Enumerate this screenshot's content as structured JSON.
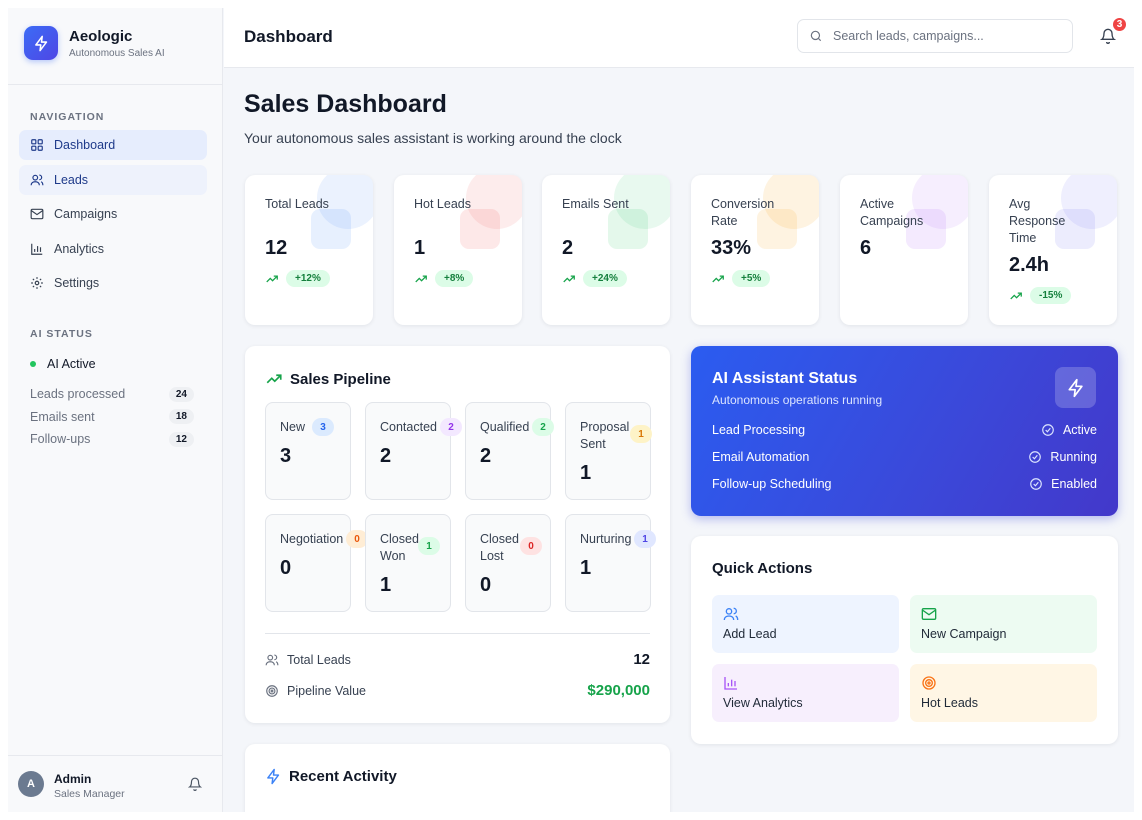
{
  "brand": {
    "name": "Aeologic",
    "subtitle": "Autonomous Sales AI"
  },
  "sidebar": {
    "nav_heading": "NAVIGATION",
    "items": [
      {
        "label": "Dashboard",
        "icon": "grid-icon",
        "state": "active"
      },
      {
        "label": "Leads",
        "icon": "users-icon",
        "state": "highlighted"
      },
      {
        "label": "Campaigns",
        "icon": "mail-icon",
        "state": "default"
      },
      {
        "label": "Analytics",
        "icon": "bar-chart-icon",
        "state": "default"
      },
      {
        "label": "Settings",
        "icon": "gear-icon",
        "state": "default"
      }
    ],
    "ai_heading": "AI STATUS",
    "ai_active_label": "AI Active",
    "stats": [
      {
        "label": "Leads processed",
        "value": "24"
      },
      {
        "label": "Emails sent",
        "value": "18"
      },
      {
        "label": "Follow-ups",
        "value": "12"
      }
    ],
    "user": {
      "initial": "A",
      "name": "Admin",
      "role": "Sales Manager"
    }
  },
  "header": {
    "title": "Dashboard",
    "search_placeholder": "Search leads, campaigns...",
    "notification_count": "3"
  },
  "main": {
    "title": "Sales Dashboard",
    "subtitle": "Your autonomous sales assistant is working around the clock",
    "kpis": [
      {
        "label": "Total Leads",
        "value": "12",
        "trend": "+12%",
        "accent": "#3b82f6"
      },
      {
        "label": "Hot Leads",
        "value": "1",
        "trend": "+8%",
        "accent": "#ef4444"
      },
      {
        "label": "Emails Sent",
        "value": "2",
        "trend": "+24%",
        "accent": "#22c55e"
      },
      {
        "label": "Conversion Rate",
        "value": "33%",
        "trend": "+5%",
        "accent": "#f59e0b"
      },
      {
        "label": "Active Campaigns",
        "value": "6",
        "trend": "",
        "accent": "#a855f7"
      },
      {
        "label": "Avg Response Time",
        "value": "2.4h",
        "trend": "-15%",
        "accent": "#6366f1"
      }
    ]
  },
  "pipeline": {
    "title": "Sales Pipeline",
    "stages": [
      {
        "name": "New",
        "count": "3",
        "badge": "3",
        "color": "#3b82f6"
      },
      {
        "name": "Contacted",
        "count": "2",
        "badge": "2",
        "color": "#a855f7"
      },
      {
        "name": "Qualified",
        "count": "2",
        "badge": "2",
        "color": "#22c55e"
      },
      {
        "name": "Proposal Sent",
        "count": "1",
        "badge": "1",
        "color": "#f59e0b"
      },
      {
        "name": "Negotiation",
        "count": "0",
        "badge": "0",
        "color": "#f97316"
      },
      {
        "name": "Closed Won",
        "count": "1",
        "badge": "1",
        "color": "#16a34a"
      },
      {
        "name": "Closed Lost",
        "count": "0",
        "badge": "0",
        "color": "#ef4444"
      },
      {
        "name": "Nurturing",
        "count": "1",
        "badge": "1",
        "color": "#6366f1"
      }
    ],
    "total_label": "Total Leads",
    "total_value": "12",
    "value_label": "Pipeline Value",
    "value_amount": "$290,000"
  },
  "ai_status": {
    "title": "AI Assistant Status",
    "subtitle": "Autonomous operations running",
    "rows": [
      {
        "label": "Lead Processing",
        "status": "Active"
      },
      {
        "label": "Email Automation",
        "status": "Running"
      },
      {
        "label": "Follow-up Scheduling",
        "status": "Enabled"
      }
    ]
  },
  "quick_actions": {
    "title": "Quick Actions",
    "items": [
      {
        "label": "Add Lead",
        "icon": "users-icon",
        "color": "#3b82f6"
      },
      {
        "label": "New Campaign",
        "icon": "mail-icon",
        "color": "#16a34a"
      },
      {
        "label": "View Analytics",
        "icon": "bar-chart-icon",
        "color": "#a855f7"
      },
      {
        "label": "Hot Leads",
        "icon": "target-icon",
        "color": "#f97316"
      }
    ]
  },
  "recent_activity": {
    "title": "Recent Activity"
  }
}
